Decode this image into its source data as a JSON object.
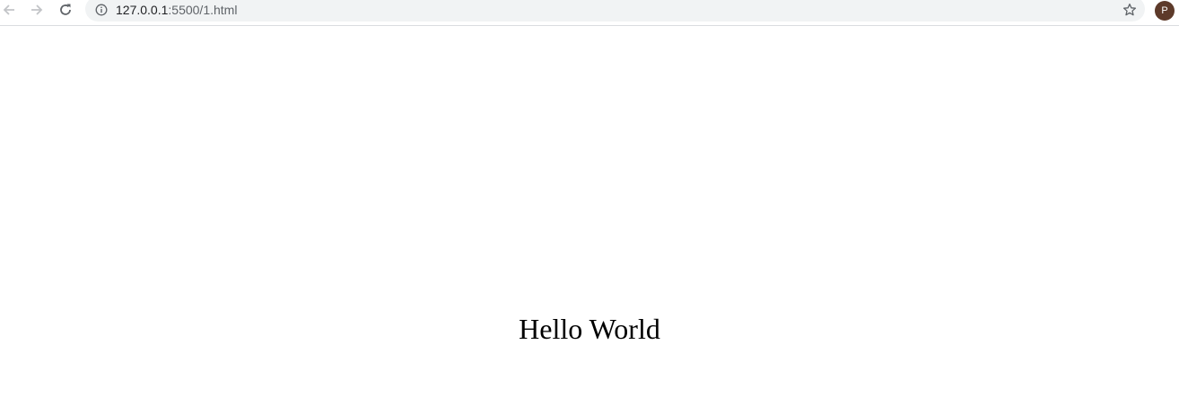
{
  "browser": {
    "url_host": "127.0.0.1",
    "url_path": ":5500/1.html",
    "profile_initial": "P",
    "avatar_color": "#5d3a2a",
    "icons": {
      "back": "arrow-left-icon",
      "forward": "arrow-right-icon",
      "reload": "reload-icon",
      "info": "info-icon",
      "bookmark": "star-icon"
    }
  },
  "page": {
    "heading": "Hello World"
  }
}
